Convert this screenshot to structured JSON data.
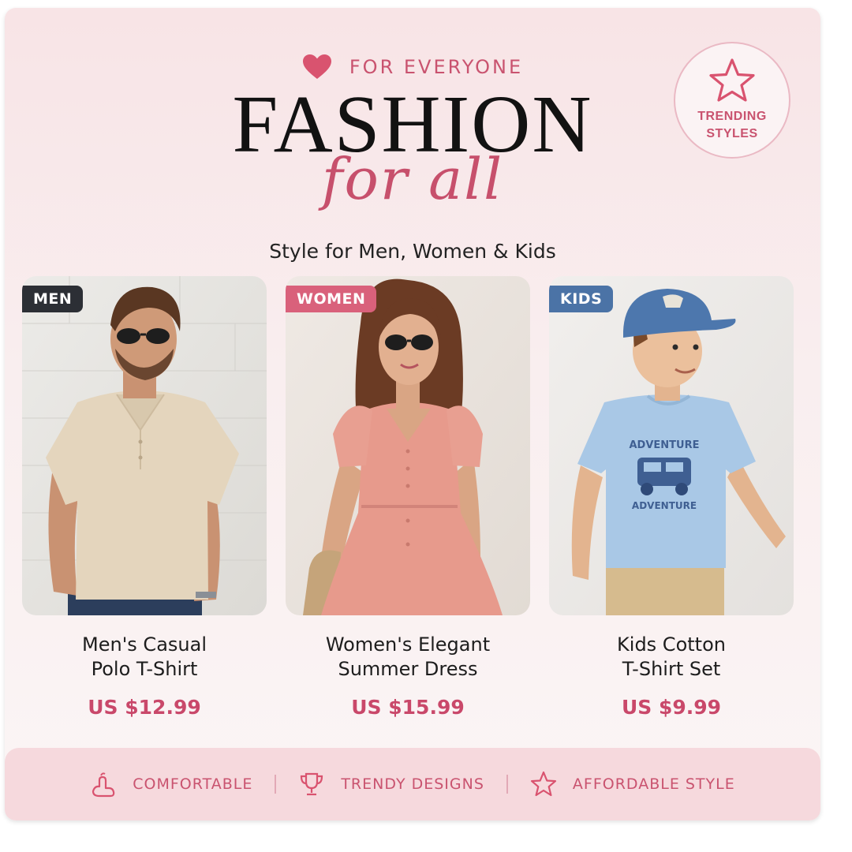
{
  "header": {
    "eyebrow": "FOR EVERYONE",
    "eyebrow_icon": "heart-icon",
    "title": "FASHION",
    "script": "for all",
    "subtitle": "Style for Men, Women & Kids"
  },
  "badge": {
    "icon": "star-icon",
    "line1": "TRENDING",
    "line2": "STYLES"
  },
  "products": [
    {
      "tag": "MEN",
      "name_line1": "Men's Casual",
      "name_line2": "Polo T-Shirt",
      "price": "US $12.99"
    },
    {
      "tag": "WOMEN",
      "name_line1": "Women's Elegant",
      "name_line2": "Summer Dress",
      "price": "US $15.99"
    },
    {
      "tag": "KIDS",
      "name_line1": "Kids Cotton",
      "name_line2": "T-Shirt Set",
      "price": "US $9.99"
    }
  ],
  "kids_shirt_print": {
    "top": "ADVENTURE",
    "bottom": "ADVENTURE"
  },
  "features": [
    {
      "icon": "comfort-icon",
      "label": "COMFORTABLE"
    },
    {
      "icon": "trophy-icon",
      "label": "TRENDY DESIGNS"
    },
    {
      "icon": "star-outline-icon",
      "label": "AFFORDABLE STYLE"
    }
  ],
  "colors": {
    "accent": "#c9536f",
    "price": "#c9486a",
    "tag_men": "#2c2f35",
    "tag_women": "#d9617b",
    "tag_kids": "#4b73a6"
  }
}
